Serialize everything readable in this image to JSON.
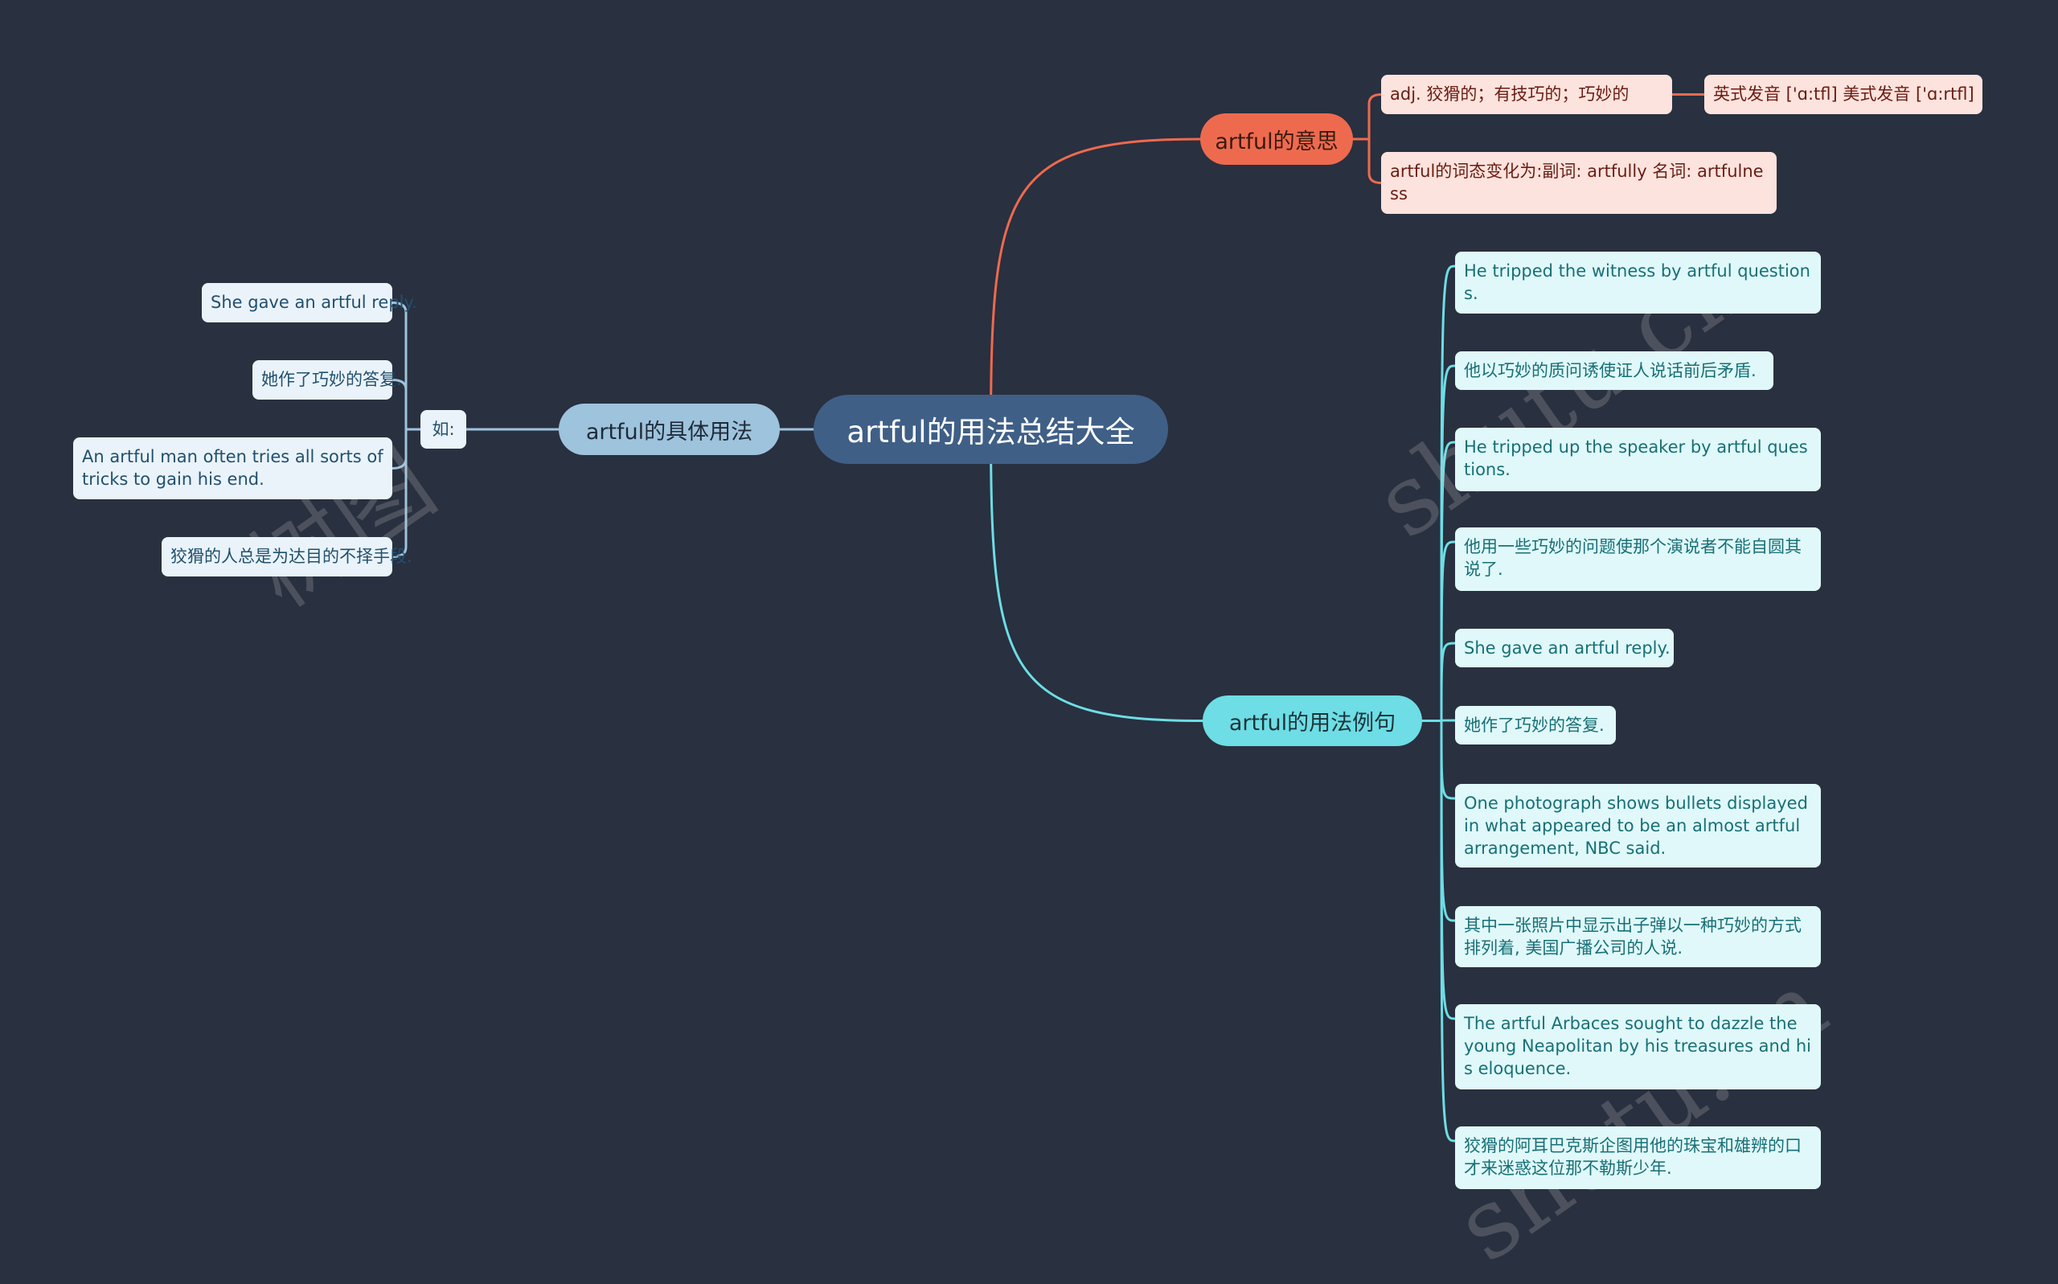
{
  "colors": {
    "background": "#29303f",
    "root": "#3f5f86",
    "meaning_branch": "#ee6a4f",
    "usage_branch": "#9ec3dc",
    "examples_branch": "#6edde5"
  },
  "root": {
    "label": "artful的用法总结大全"
  },
  "meaning": {
    "label": "artful的意思",
    "children": [
      {
        "label": "adj. 狡猾的；有技巧的；巧妙的",
        "children": [
          {
            "label": "英式发音 ['ɑ:tfl] 美式发音 ['ɑ:rtfl]"
          }
        ]
      },
      {
        "label": "artful的词态变化为:副词: artfully 名词: artfulness"
      }
    ]
  },
  "usage": {
    "label": "artful的具体用法",
    "connector": {
      "label": "如:"
    },
    "children": [
      {
        "label": "She gave an artful reply."
      },
      {
        "label": "她作了巧妙的答复."
      },
      {
        "label": "An artful man often tries all sorts of tricks  to gain his end."
      },
      {
        "label": "狡猾的人总是为达目的不择手段."
      }
    ]
  },
  "examples": {
    "label": "artful的用法例句",
    "children": [
      {
        "label": "He tripped the witness by artful questions."
      },
      {
        "label": "他以巧妙的质问诱使证人说话前后矛盾."
      },
      {
        "label": "He tripped up the speaker by artful questions."
      },
      {
        "label": "他用一些巧妙的问题使那个演说者不能自圆其说了."
      },
      {
        "label": "She gave an artful reply."
      },
      {
        "label": "她作了巧妙的答复."
      },
      {
        "label": "One photograph shows bullets displayed in what appeared to be an almost artful arrangement, NBC said."
      },
      {
        "label": "其中一张照片中显示出子弹以一种巧妙的方式排列着, 美国广播公司的人说."
      },
      {
        "label": "The artful Arbaces sought to dazzle the young Neapolitan by his treasures and his eloquence."
      },
      {
        "label": "狡猾的阿耳巴克斯企图用他的珠宝和雄辨的口才来迷惑这位那不勒斯少年."
      }
    ]
  },
  "watermarks": [
    "树图",
    "shutu.cn",
    "shutu.cn"
  ]
}
